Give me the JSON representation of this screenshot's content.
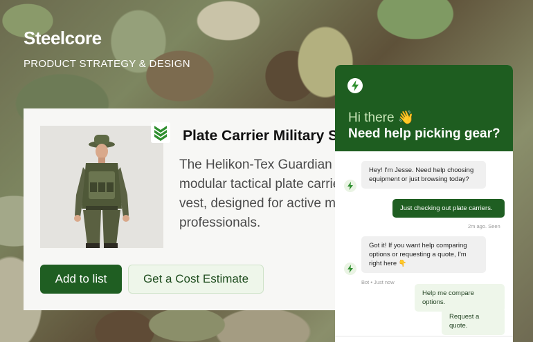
{
  "brand": {
    "name": "Steelcore",
    "tagline": "PRODUCT STRATEGY & DESIGN"
  },
  "product": {
    "title": "Plate Carrier Military Set",
    "description": "The Helikon-Tex Guardian is a modular tactical plate carrier base vest, designed for active military professionals.",
    "primary_button": "Add to list",
    "secondary_button": "Get a Cost Estimate"
  },
  "chat": {
    "greeting": "Hi there 👋",
    "headline": "Need help picking gear?",
    "messages": [
      {
        "from": "bot",
        "text": "Hey! I'm Jesse. Need help choosing equipment or just browsing today?"
      },
      {
        "from": "user",
        "text": "Just checking out plate carriers.",
        "meta": "2m ago. Seen"
      },
      {
        "from": "bot",
        "text": "Got it! If you want help comparing options or requesting a quote, I'm right here 👇",
        "meta": "Bot • Just now"
      }
    ],
    "quick_replies": [
      "Help me compare options.",
      "Request a quote."
    ]
  },
  "colors": {
    "primary": "#1f5e22",
    "chip_bg": "#eef6ea"
  }
}
